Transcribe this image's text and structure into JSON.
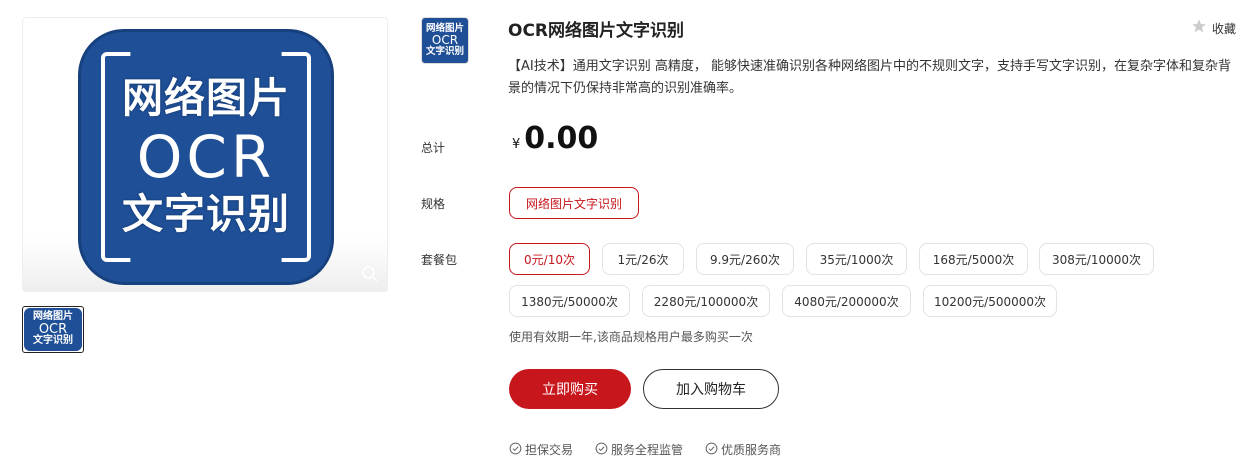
{
  "gallery": {
    "main_icon": {
      "line1": "网络图片",
      "line2": "OCR",
      "line3": "文字识别"
    },
    "thumb_icon": {
      "line1": "网络图片",
      "line2": "OCR",
      "line3": "文字识别"
    },
    "zoom_icon": "magnifier-icon"
  },
  "product": {
    "logo": {
      "line1": "网络图片",
      "line2": "OCR",
      "line3": "文字识别"
    },
    "title": "OCR网络图片文字识别",
    "favorite_label": "收藏",
    "favorite_icon": "star-icon",
    "description": "【AI技术】通用文字识别 高精度， 能够快速准确识别各种网络图片中的不规则文字，支持手写文字识别，在复杂字体和复杂背景的情况下仍保持非常高的识别准确率。"
  },
  "pricing": {
    "total_label": "总计",
    "currency": "¥",
    "amount": "0.00"
  },
  "spec": {
    "label": "规格",
    "options": [
      "网络图片文字识别"
    ],
    "selected": "网络图片文字识别"
  },
  "package": {
    "label": "套餐包",
    "options": [
      "0元/10次",
      "1元/26次",
      "9.9元/260次",
      "35元/1000次",
      "168元/5000次",
      "308元/10000次",
      "1380元/50000次",
      "2280元/100000次",
      "4080元/200000次",
      "10200元/500000次"
    ],
    "selected": "0元/10次",
    "note": "使用有效期一年,该商品规格用户最多购买一次"
  },
  "actions": {
    "buy_now": "立即购买",
    "add_to_cart": "加入购物车"
  },
  "guarantees": [
    "担保交易",
    "服务全程监管",
    "优质服务商"
  ],
  "colors": {
    "accent": "#c8161d",
    "icon_blue": "#1f4f96"
  }
}
